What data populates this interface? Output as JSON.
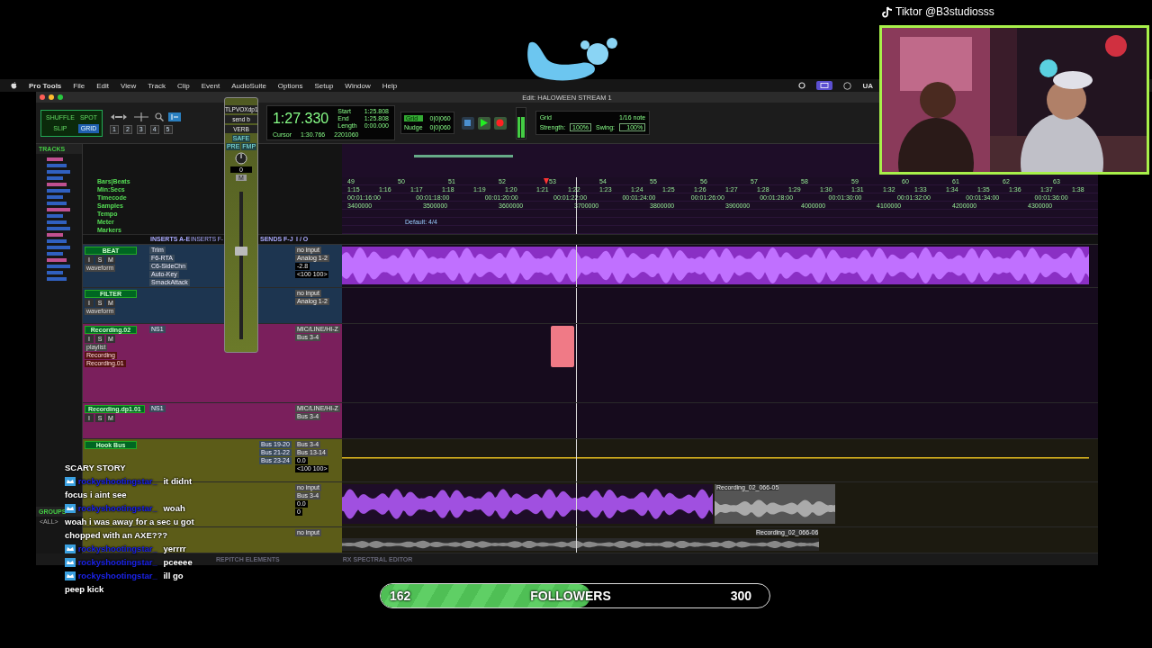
{
  "overlay": {
    "tiktok_handle": "Tiktor @B3studiosss"
  },
  "menu_bar": {
    "app": "Pro Tools",
    "items": [
      "File",
      "Edit",
      "View",
      "Track",
      "Clip",
      "Event",
      "AudioSuite",
      "Options",
      "Setup",
      "Window",
      "Help"
    ],
    "status_text": "UA"
  },
  "window": {
    "title": "Edit: HALOWEEN STREAM 1"
  },
  "edit_modes": [
    {
      "label": "SHUFFLE",
      "selected": false
    },
    {
      "label": "SPOT",
      "selected": false
    },
    {
      "label": "SLIP",
      "selected": false
    },
    {
      "label": "GRID",
      "selected": true
    }
  ],
  "zoom_presets": [
    "1",
    "2",
    "3",
    "4",
    "5"
  ],
  "counter": {
    "main": "1:27.330",
    "fields": [
      {
        "label": "Start",
        "value": "1:25.808"
      },
      {
        "label": "End",
        "value": "1:25.808"
      },
      {
        "label": "Length",
        "value": "0:00.000"
      }
    ],
    "cursor_label": "Cursor",
    "cursor": "1:30.766",
    "samples": "2201060"
  },
  "grid_nudge": [
    {
      "label": "Grid",
      "value": "0|0|060",
      "selected": true
    },
    {
      "label": "Nudge",
      "value": "0|0|060",
      "selected": false
    }
  ],
  "transport": [
    {
      "kind": "stop",
      "on": false
    },
    {
      "kind": "play",
      "on": true
    },
    {
      "kind": "record",
      "on": true
    }
  ],
  "quantize": {
    "label": "Grid",
    "note": "1/16 note",
    "strength_label": "Strength:",
    "strength": "100%",
    "swing_label": "Swing:",
    "swing": "100%"
  },
  "fader_window": {
    "track": "TLPVOXdp1",
    "send": "send b",
    "output": "VERB",
    "buttons": [
      "SAFE",
      "PRE",
      "FMP"
    ],
    "value": "0",
    "mute": "M",
    "level": 0.6
  },
  "tracks_panel": {
    "title": "TRACKS",
    "groups_title": "GROUPS",
    "group": "<ALL>"
  },
  "rulers": {
    "names": [
      "Bars|Beats",
      "Min:Secs",
      "Timecode",
      "Samples",
      "Tempo",
      "Meter",
      "Markers"
    ],
    "bars": [
      "49",
      "50",
      "51",
      "52",
      "53",
      "54",
      "55",
      "56",
      "57",
      "58",
      "59",
      "60",
      "61",
      "62",
      "63"
    ],
    "min_secs": [
      "1:15",
      "1:16",
      "1:17",
      "1:18",
      "1:19",
      "1:20",
      "1:21",
      "1:22",
      "1:23",
      "1:24",
      "1:25",
      "1:26",
      "1:27",
      "1:28",
      "1:29",
      "1:30",
      "1:31",
      "1:32",
      "1:33",
      "1:34",
      "1:35",
      "1:36",
      "1:37",
      "1:38"
    ],
    "timecode": [
      "00:01:16:00",
      "00:01:18:00",
      "00:01:20:00",
      "00:01:22:00",
      "00:01:24:00",
      "00:01:26:00",
      "00:01:28:00",
      "00:01:30:00",
      "00:01:32:00",
      "00:01:34:00",
      "00:01:36:00"
    ],
    "samples": [
      "3400000",
      "3500000",
      "3600000",
      "3700000",
      "3800000",
      "3900000",
      "4000000",
      "4100000",
      "4200000",
      "4300000"
    ],
    "meter": "Default: 4/4"
  },
  "mix_headers": [
    "INSERTS A-E",
    "INSERTS F-",
    "SENDS F-J",
    "I / O"
  ],
  "tracks": [
    {
      "name": "BEAT",
      "color": "#1d3550",
      "buttons": [
        "I",
        "S",
        "M"
      ],
      "view": "waveform",
      "inserts": [
        "Trim",
        "F6-RTA",
        "C6-SideChn",
        "Auto-Key",
        "SmackAttack"
      ],
      "io": [
        "no input",
        "Analog 1-2"
      ],
      "vol": "-2.8",
      "pan": [
        "<100",
        "100>"
      ],
      "clip": {
        "kind": "waveform"
      }
    },
    {
      "name": "FILTER",
      "color": "#1d3550",
      "buttons": [
        "I",
        "S",
        "M"
      ],
      "view": "waveform",
      "io": [
        "no input",
        "Analog 1-2"
      ]
    },
    {
      "name": "Recording.02",
      "color": "#7a1f5c",
      "buttons": [
        "I",
        "S",
        "M"
      ],
      "view": "playlist",
      "inserts": [
        "NS1"
      ],
      "io": [
        "MIC/LINE/HI-Z",
        "Bus 3-4"
      ],
      "playlists": [
        "Recording",
        "Recording.01"
      ],
      "clip": {
        "kind": "block"
      }
    },
    {
      "name": "Recording.dp1.01",
      "color": "#7a1f5c",
      "buttons": [
        "I",
        "S",
        "M"
      ],
      "inserts": [
        "NS1"
      ],
      "io": [
        "MIC/LINE/HI-Z",
        "Bus 3-4"
      ]
    },
    {
      "name": "Hook Bus",
      "color": "#5c5c18",
      "sends": [
        "Bus 19-20",
        "Bus 21-22",
        "Bus 23-24"
      ],
      "io": [
        "Bus 3-4",
        "Bus 13-14"
      ],
      "vol": "0.0",
      "pan": [
        "<100",
        "100>"
      ],
      "clip": {
        "kind": "line"
      }
    },
    {
      "color": "#5c5c18",
      "io": [
        "no input",
        "Bus 3-4"
      ],
      "vol": "0.0",
      "pan": [
        "0"
      ],
      "clip": {
        "kind": "waveform-tail",
        "label": "Recording_02_066-05"
      }
    },
    {
      "color": "#5c5c18",
      "io": [
        "no input"
      ],
      "clip": {
        "kind": "strip",
        "label": "Recording_02_066-06"
      }
    }
  ],
  "bottom_tabs": [
    "REPITCH ELEMENTS",
    "RX SPECTRAL EDITOR"
  ],
  "chat": [
    {
      "text": "SCARY STORY"
    },
    {
      "user": "rockyshootingstar_",
      "text": "it didnt focus i aint see"
    },
    {
      "user": "rockyshootingstar_",
      "text": "woah woah i was away for a sec u got chopped with an AXE???"
    },
    {
      "user": "rockyshootingstar_",
      "text": "yerrrr"
    },
    {
      "user": "rockyshootingstar_",
      "text": "pceeee"
    },
    {
      "user": "rockyshootingstar_",
      "text": "ill go peep kick"
    }
  ],
  "followers": {
    "current": "162",
    "label": "FOLLOWERS",
    "goal": "300",
    "level": 0.54
  }
}
